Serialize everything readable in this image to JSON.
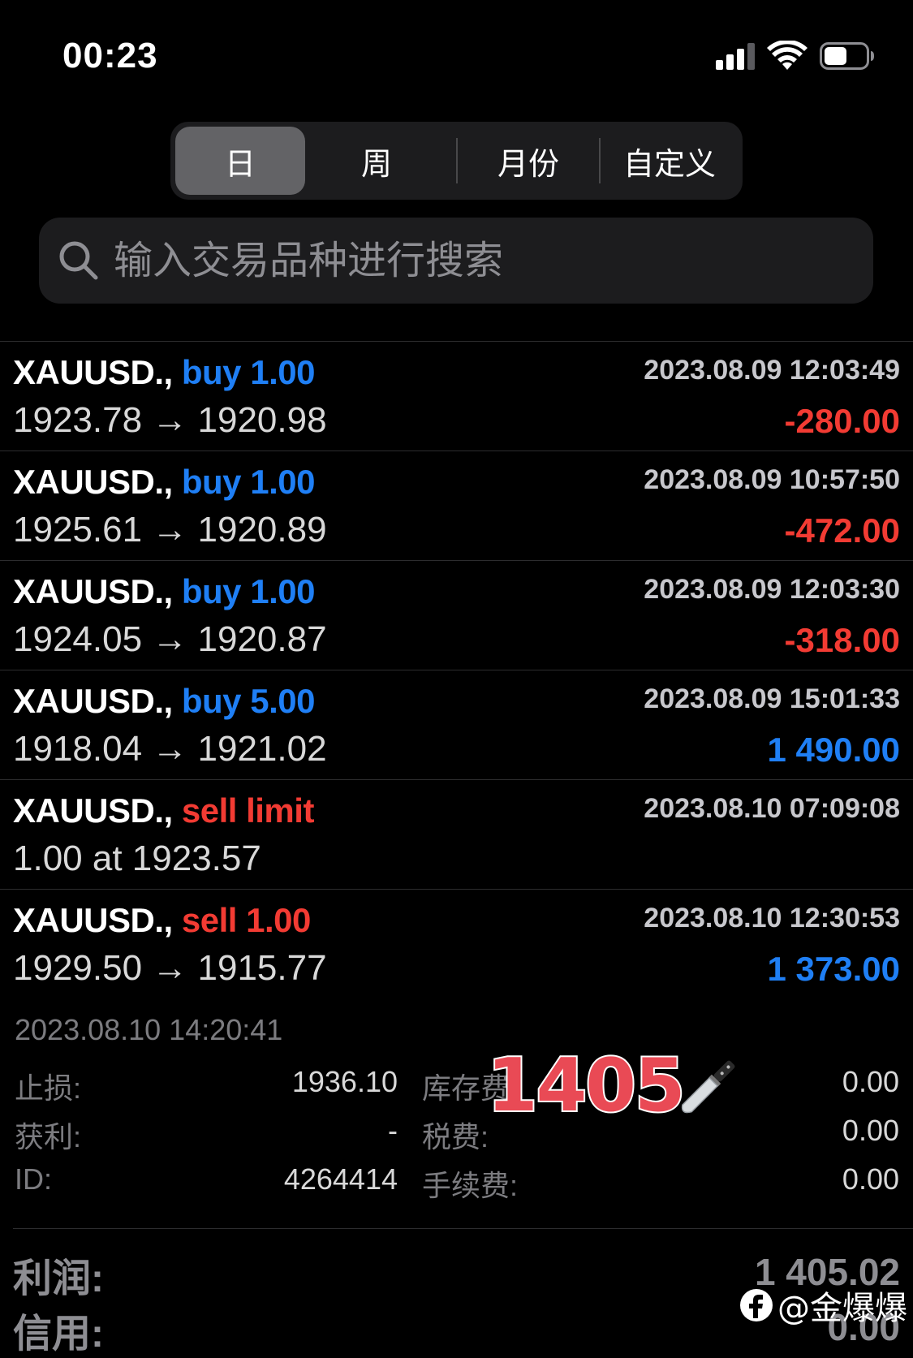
{
  "status": {
    "time": "00:23"
  },
  "tabs": [
    {
      "label": "日",
      "active": true
    },
    {
      "label": "周",
      "active": false
    },
    {
      "label": "月份",
      "active": false
    },
    {
      "label": "自定义",
      "active": false
    }
  ],
  "search": {
    "placeholder": "输入交易品种进行搜索"
  },
  "trades": [
    {
      "symbol": "XAUUSD.,",
      "side": "buy",
      "volume": "1.00",
      "side_color": "blue",
      "prices": "1923.78 → 1920.98",
      "datetime": "2023.08.09 12:03:49",
      "profit": "-280.00",
      "profit_color": "red"
    },
    {
      "symbol": "XAUUSD.,",
      "side": "buy",
      "volume": "1.00",
      "side_color": "blue",
      "prices": "1925.61 → 1920.89",
      "datetime": "2023.08.09 10:57:50",
      "profit": "-472.00",
      "profit_color": "red"
    },
    {
      "symbol": "XAUUSD.,",
      "side": "buy",
      "volume": "1.00",
      "side_color": "blue",
      "prices": "1924.05 → 1920.87",
      "datetime": "2023.08.09 12:03:30",
      "profit": "-318.00",
      "profit_color": "red"
    },
    {
      "symbol": "XAUUSD.,",
      "side": "buy",
      "volume": "5.00",
      "side_color": "blue",
      "prices": "1918.04 → 1921.02",
      "datetime": "2023.08.09 15:01:33",
      "profit": "1 490.00",
      "profit_color": "blue"
    },
    {
      "symbol": "XAUUSD.,",
      "side": "sell limit",
      "volume": "",
      "side_color": "red",
      "prices": "1.00 at 1923.57",
      "datetime": "2023.08.10 07:09:08",
      "profit": "",
      "profit_color": "blue"
    },
    {
      "symbol": "XAUUSD.,",
      "side": "sell",
      "volume": "1.00",
      "side_color": "red",
      "prices": "1929.50 → 1915.77",
      "datetime": "2023.08.10 12:30:53",
      "profit": "1 373.00",
      "profit_color": "blue"
    }
  ],
  "details": {
    "time": "2023.08.10 14:20:41",
    "stop_loss_label": "止损:",
    "stop_loss": "1936.10",
    "take_profit_label": "获利:",
    "take_profit": "-",
    "id_label": "ID:",
    "id": "4264414",
    "swap_label": "库存费:",
    "swap": "0.00",
    "tax_label": "税费:",
    "tax": "0.00",
    "commission_label": "手续费:",
    "commission": "0.00"
  },
  "sticker": {
    "text": "1405",
    "icon": "knife-icon"
  },
  "summary": {
    "profit_label": "利润:",
    "profit": "1 405.02",
    "credit_label": "信用:",
    "credit": "0.00"
  },
  "watermark": {
    "text": "@金爆爆"
  },
  "colors": {
    "blue": "#1f7ff5",
    "red": "#f23b33",
    "segment_bg": "#1c1c1e",
    "segment_active": "#636366"
  }
}
